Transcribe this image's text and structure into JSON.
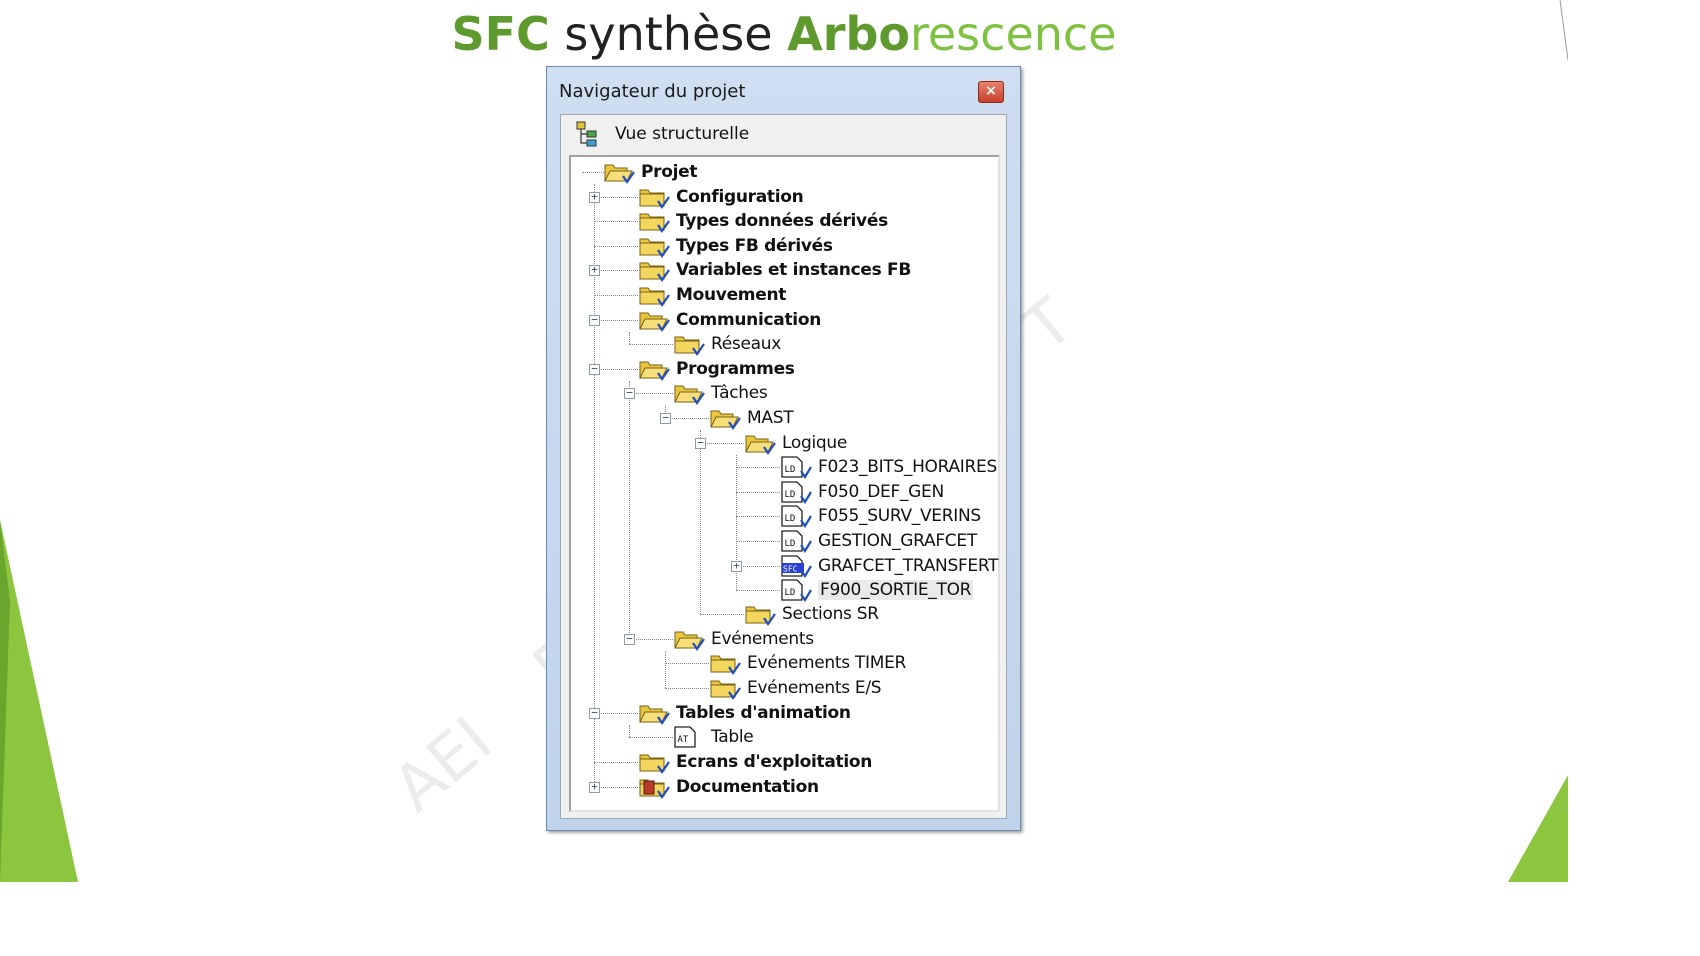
{
  "slide": {
    "title_part1": "SFC",
    "title_part2": " synthèse ",
    "title_part3": "Arbo",
    "title_part4": "rescence"
  },
  "watermark": {
    "text1": "AEI",
    "text2": "F",
    "text3": "T"
  },
  "window": {
    "title": "Navigateur du projet",
    "close_label": "×",
    "view_label": "Vue structurelle"
  },
  "colors": {
    "title_green_bold": "#5e9a2e",
    "title_green_light": "#7fc241",
    "close_red": "#c7402a",
    "folder_yellow": "#f2d24f",
    "arrow_blue": "#1f4fbf"
  },
  "tree": {
    "projet": "Projet",
    "configuration": "Configuration",
    "types_donnees": "Types données dérivés",
    "types_fb": "Types FB dérivés",
    "variables": "Variables et instances FB",
    "mouvement": "Mouvement",
    "communication": "Communication",
    "reseaux": "Réseaux",
    "programmes": "Programmes",
    "taches": "Tâches",
    "mast": "MAST",
    "logique": "Logique",
    "f023": "F023_BITS_HORAIRES",
    "f050": "F050_DEF_GEN",
    "f055": "F055_SURV_VERINS",
    "gestion_grafcet": "GESTION_GRAFCET",
    "grafcet_transfert": "GRAFCET_TRANSFERT",
    "f900": "F900_SORTIE_TOR",
    "sections_sr": "Sections SR",
    "evenements": "Evénements",
    "evenements_timer": "Evénements TIMER",
    "evenements_es": "Evénements E/S",
    "tables_animation": "Tables d'animation",
    "table": "Table",
    "ecrans": "Ecrans d'exploitation",
    "documentation": "Documentation"
  },
  "icons": {
    "ld_tag": "LD",
    "sfc_tag": "SFC",
    "at_tag": "AT"
  },
  "expanders": {
    "plus": "+",
    "minus": "−"
  }
}
